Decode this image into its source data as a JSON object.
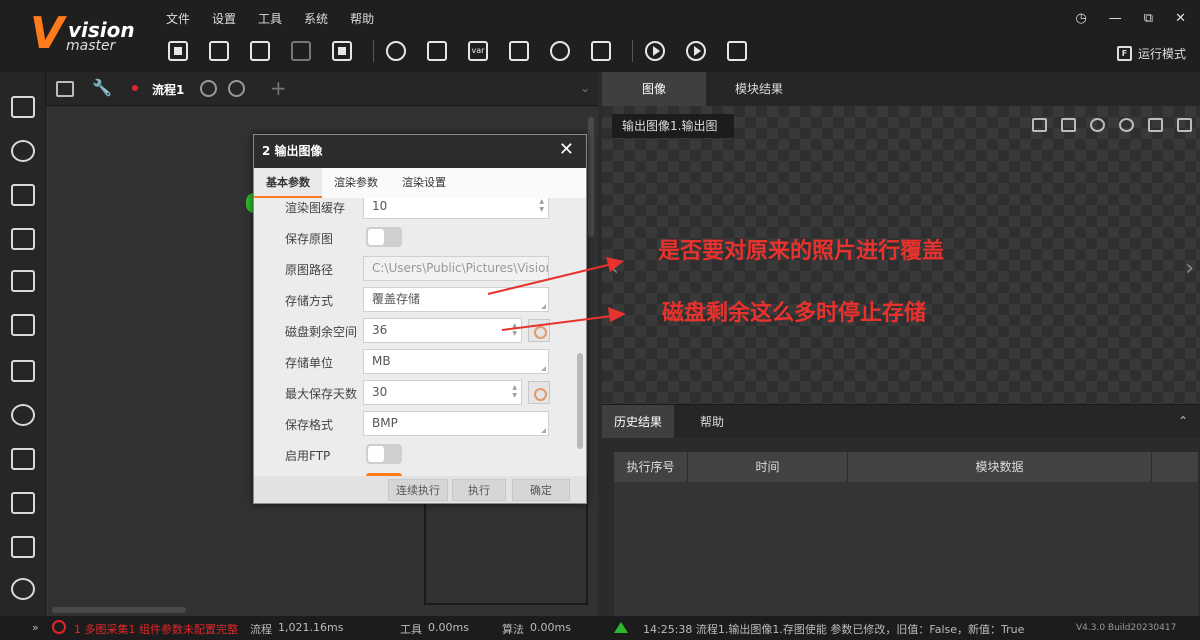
{
  "app": {
    "logo_v": "V",
    "logo_line1": "vision",
    "logo_line2": "master"
  },
  "menu": [
    "文件",
    "设置",
    "工具",
    "系统",
    "帮助"
  ],
  "toolbar_icons": [
    "save-icon",
    "open-folder-icon",
    "undo-icon",
    "redo-icon",
    "lock-icon",
    "camera-icon",
    "adjust-icon",
    "var-icon",
    "device-icon",
    "refresh-icon",
    "script-icon",
    "run-once-icon",
    "run-loop-icon",
    "edit-icon"
  ],
  "toolbar_var_label": "var",
  "window": {
    "minimize": "—",
    "restore": "⧉",
    "close": "✕"
  },
  "run_mode": {
    "icon_text": "F",
    "label": "运行模式"
  },
  "flow": {
    "name": "流程1",
    "add": "+"
  },
  "dialog": {
    "title": "2 输出图像",
    "close": "✕",
    "tabs": [
      "基本参数",
      "渲染参数",
      "渲染设置"
    ],
    "rows": [
      {
        "label": "渲染图缓存",
        "value": "10"
      },
      {
        "label": "保存原图",
        "value": ""
      },
      {
        "label": "原图路径",
        "value": "C:\\Users\\Public\\Pictures\\Vision"
      },
      {
        "label": "存储方式",
        "value": "覆盖存储"
      },
      {
        "label": "磁盘剩余空间",
        "value": "36"
      },
      {
        "label": "存储单位",
        "value": "MB"
      },
      {
        "label": "最大保存天数",
        "value": "30"
      },
      {
        "label": "保存格式",
        "value": "BMP"
      },
      {
        "label": "启用FTP",
        "value": ""
      }
    ],
    "buttons": {
      "continuous": "连续执行",
      "execute": "执行",
      "confirm": "确定"
    }
  },
  "image_panel": {
    "tabs": [
      "图像",
      "模块结果"
    ],
    "selector": "输出图像1.输出图",
    "nav_left": "‹",
    "nav_right": "›"
  },
  "annotations": [
    "是否要对原来的照片进行覆盖",
    "磁盘剩余这么多时停止存储"
  ],
  "history": {
    "tabs": [
      "历史结果",
      "帮助"
    ],
    "columns": [
      "执行序号",
      "时间",
      "模块数据"
    ]
  },
  "status": {
    "error": "1 多图采集1 组件参数未配置完整",
    "flow_label": "流程",
    "flow_time": "1,021.16ms",
    "tool_label": "工具",
    "tool_time": "0.00ms",
    "algo_label": "算法",
    "algo_time": "0.00ms",
    "log": "14:25:38  流程1.输出图像1.存图使能 参数已修改，旧值：False，新值：True",
    "version": "V4.3.0 Build20230417"
  },
  "colors": {
    "accent": "#ff7a1a",
    "annotation": "#e8322e",
    "error": "#e0262b"
  }
}
